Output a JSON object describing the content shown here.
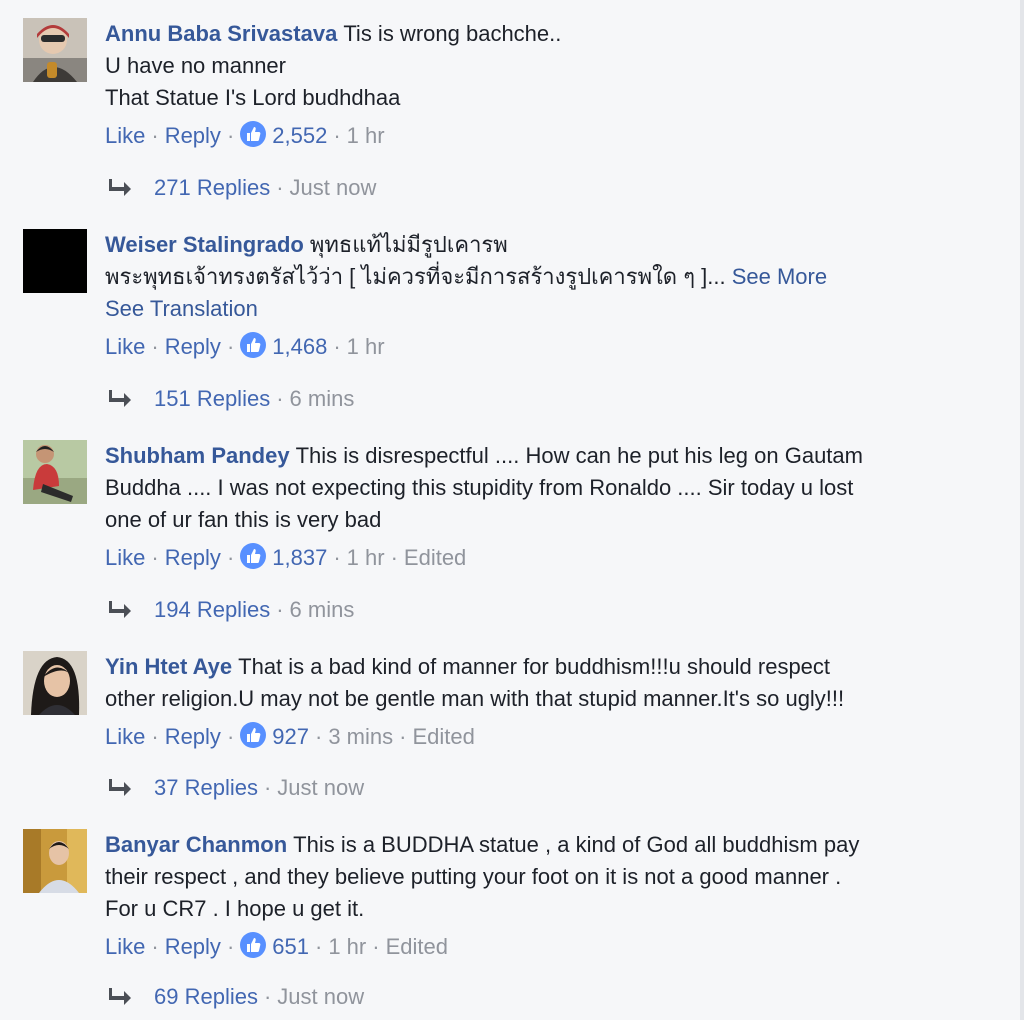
{
  "colors": {
    "link": "#365899",
    "action": "#4267b2",
    "meta": "#90949c",
    "text": "#1d2129",
    "background": "#f6f7f9"
  },
  "comments": [
    {
      "author": "Annu Baba Srivastava",
      "lines": [
        "Tis is wrong bachche..",
        "U have no manner",
        "That Statue I's Lord budhdhaa"
      ],
      "see_more": "",
      "see_translation": "",
      "like": "Like",
      "reply": "Reply",
      "likes": "2,552",
      "time": "1 hr",
      "edited": "",
      "replies_label": "271 Replies",
      "replies_time": "Just now",
      "avatar_icon": "person-with-helmet-avatar"
    },
    {
      "author": "Weiser Stalingrado",
      "lines": [
        "พุทธแท้ไม่มีรูปเคารพ",
        "พระพุทธเจ้าทรงตรัสไว้ว่า [ ไม่ควรที่จะมีการสร้างรูปเคารพใด ๆ ]..."
      ],
      "see_more": "See More",
      "see_translation": "See Translation",
      "like": "Like",
      "reply": "Reply",
      "likes": "1,468",
      "time": "1 hr",
      "edited": "",
      "replies_label": "151 Replies",
      "replies_time": "6 mins",
      "avatar_icon": "black-square-avatar"
    },
    {
      "author": "Shubham Pandey",
      "lines": [
        "This is disrespectful .... How can he put his leg on Gautam",
        "Buddha .... I was not expecting this stupidity from Ronaldo .... Sir today u lost",
        "one of ur fan this is very bad"
      ],
      "see_more": "",
      "see_translation": "",
      "like": "Like",
      "reply": "Reply",
      "likes": "1,837",
      "time": "1 hr",
      "edited": "Edited",
      "replies_label": "194 Replies",
      "replies_time": "6 mins",
      "avatar_icon": "person-red-shirt-avatar"
    },
    {
      "author": "Yin Htet Aye",
      "lines": [
        "That is a bad kind of manner for buddhism!!!u should respect",
        "other religion.U may not be gentle man with that stupid manner.It's so ugly!!!"
      ],
      "see_more": "",
      "see_translation": "",
      "like": "Like",
      "reply": "Reply",
      "likes": "927",
      "time": "3 mins",
      "edited": "Edited",
      "replies_label": "37 Replies",
      "replies_time": "Just now",
      "avatar_icon": "person-dark-hair-avatar"
    },
    {
      "author": "Banyar Chanmon",
      "lines": [
        "This is a BUDDHA statue , a kind of God all buddhism pay",
        "their respect , and they believe putting your foot on it is not a good manner .",
        "For u CR7 . I hope u get it."
      ],
      "see_more": "",
      "see_translation": "",
      "like": "Like",
      "reply": "Reply",
      "likes": "651",
      "time": "1 hr",
      "edited": "Edited",
      "replies_label": "69 Replies",
      "replies_time": "Just now",
      "avatar_icon": "person-temple-avatar"
    }
  ]
}
